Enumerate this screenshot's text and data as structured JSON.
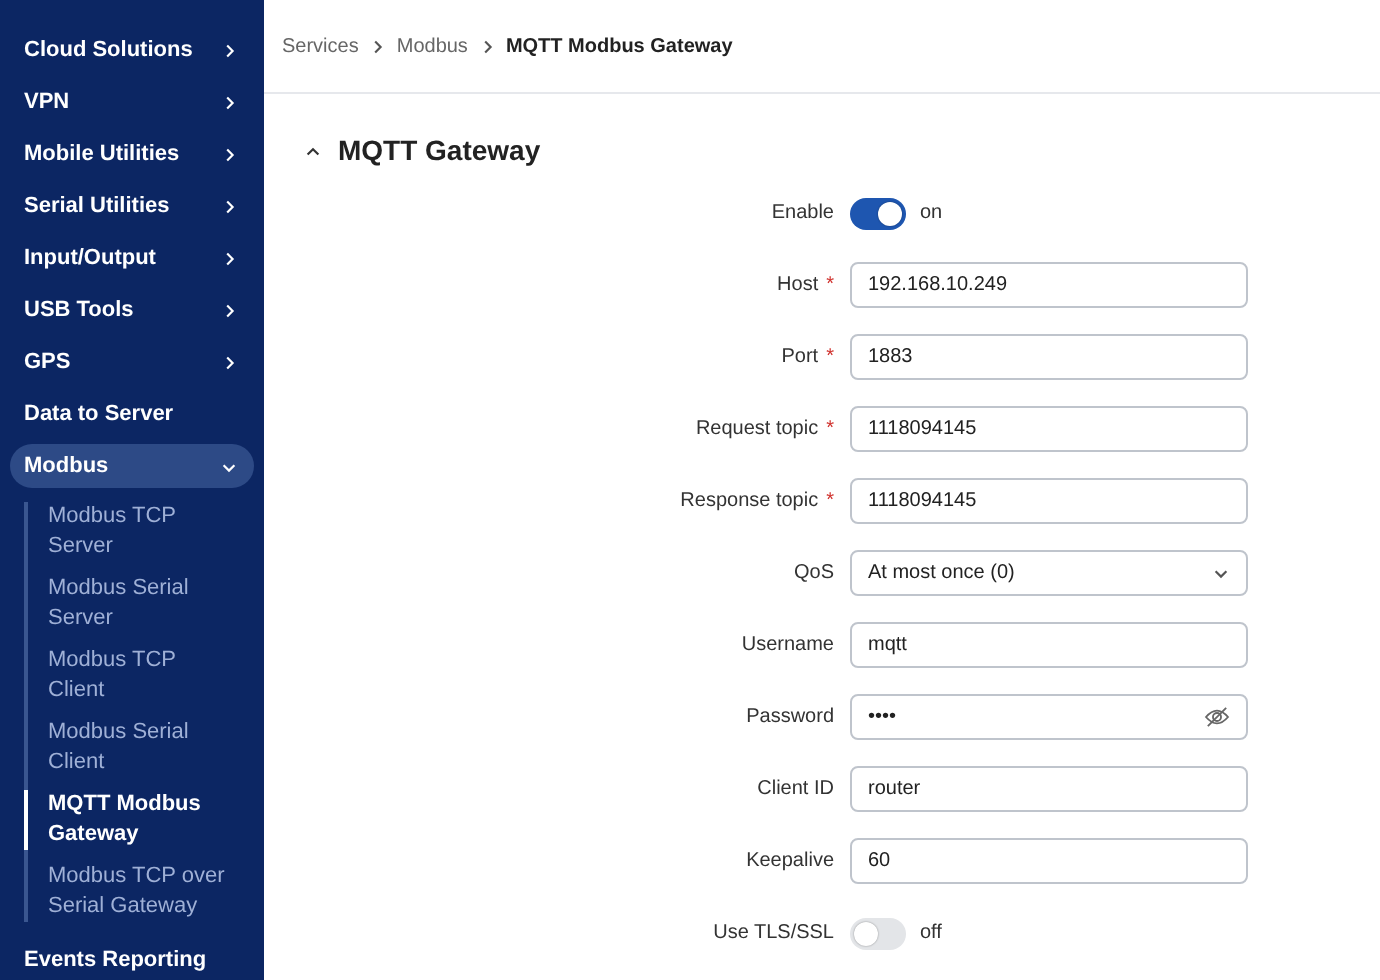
{
  "sidebar": {
    "items": [
      {
        "label": "Cloud Solutions",
        "has_arrow": true,
        "expanded": false,
        "selected": false
      },
      {
        "label": "VPN",
        "has_arrow": true,
        "expanded": false,
        "selected": false
      },
      {
        "label": "Mobile Utilities",
        "has_arrow": true,
        "expanded": false,
        "selected": false
      },
      {
        "label": "Serial Utilities",
        "has_arrow": true,
        "expanded": false,
        "selected": false
      },
      {
        "label": "Input/Output",
        "has_arrow": true,
        "expanded": false,
        "selected": false
      },
      {
        "label": "USB Tools",
        "has_arrow": true,
        "expanded": false,
        "selected": false
      },
      {
        "label": "GPS",
        "has_arrow": true,
        "expanded": false,
        "selected": false
      },
      {
        "label": "Data to Server",
        "has_arrow": false,
        "selected": false
      },
      {
        "label": "Modbus",
        "has_arrow": true,
        "expanded": true,
        "selected": true,
        "children": [
          {
            "label": "Modbus TCP Server",
            "selected": false
          },
          {
            "label": "Modbus Serial Server",
            "selected": false
          },
          {
            "label": "Modbus TCP Client",
            "selected": false
          },
          {
            "label": "Modbus Serial Client",
            "selected": false
          },
          {
            "label": "MQTT Modbus Gateway",
            "selected": true
          },
          {
            "label": "Modbus TCP over Serial Gateway",
            "selected": false
          }
        ]
      },
      {
        "label": "Events Reporting",
        "has_arrow": false,
        "selected": false
      }
    ]
  },
  "breadcrumb": [
    {
      "label": "Services",
      "current": false
    },
    {
      "label": "Modbus",
      "current": false
    },
    {
      "label": "MQTT Modbus Gateway",
      "current": true
    }
  ],
  "section": {
    "title": "MQTT Gateway",
    "expanded": true
  },
  "fields": [
    {
      "kind": "toggle",
      "label": "Enable",
      "on": true,
      "state_label": "on"
    },
    {
      "kind": "text",
      "label": "Host",
      "required_mark": "*",
      "value": "192.168.10.249"
    },
    {
      "kind": "text",
      "label": "Port",
      "required_mark": "*",
      "value": "1883"
    },
    {
      "kind": "text",
      "label": "Request topic",
      "required_mark": "*",
      "value": "1118094145"
    },
    {
      "kind": "text",
      "label": "Response topic",
      "required_mark": "*",
      "value": "1118094145"
    },
    {
      "kind": "select",
      "label": "QoS",
      "value": "At most once (0)"
    },
    {
      "kind": "text",
      "label": "Username",
      "value": "mqtt"
    },
    {
      "kind": "password",
      "label": "Password",
      "value": "••••"
    },
    {
      "kind": "text",
      "label": "Client ID",
      "value": "router"
    },
    {
      "kind": "text",
      "label": "Keepalive",
      "value": "60"
    },
    {
      "kind": "toggle",
      "label": "Use TLS/SSL",
      "on": false,
      "state_label": "off"
    }
  ]
}
